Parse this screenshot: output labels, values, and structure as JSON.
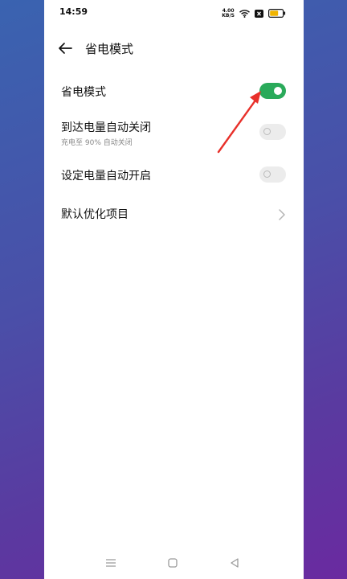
{
  "status_bar": {
    "time": "14:59",
    "speed_value": "4.00",
    "speed_unit": "KB/S",
    "icons": [
      "wifi-icon",
      "sim-x-icon",
      "battery-icon"
    ],
    "battery_color": "#f0b400"
  },
  "header": {
    "back_icon": "arrow-left-icon",
    "title": "省电模式"
  },
  "settings": {
    "items": [
      {
        "label": "省电模式",
        "toggle": true
      },
      {
        "label": "到达电量自动关闭",
        "sublabel": "充电至 90% 自动关闭",
        "toggle": false
      },
      {
        "label": "设定电量自动开启",
        "toggle": false
      },
      {
        "label": "默认优化项目",
        "chevron": true
      }
    ]
  },
  "annotation": {
    "icon": "red-arrow-icon",
    "color": "#e8302a"
  },
  "nav_bar": {
    "icons": [
      "menu-icon",
      "home-icon",
      "back-triangle-icon"
    ]
  },
  "colors": {
    "toggle_on": "#2aaa5a",
    "toggle_off": "#ececec"
  }
}
